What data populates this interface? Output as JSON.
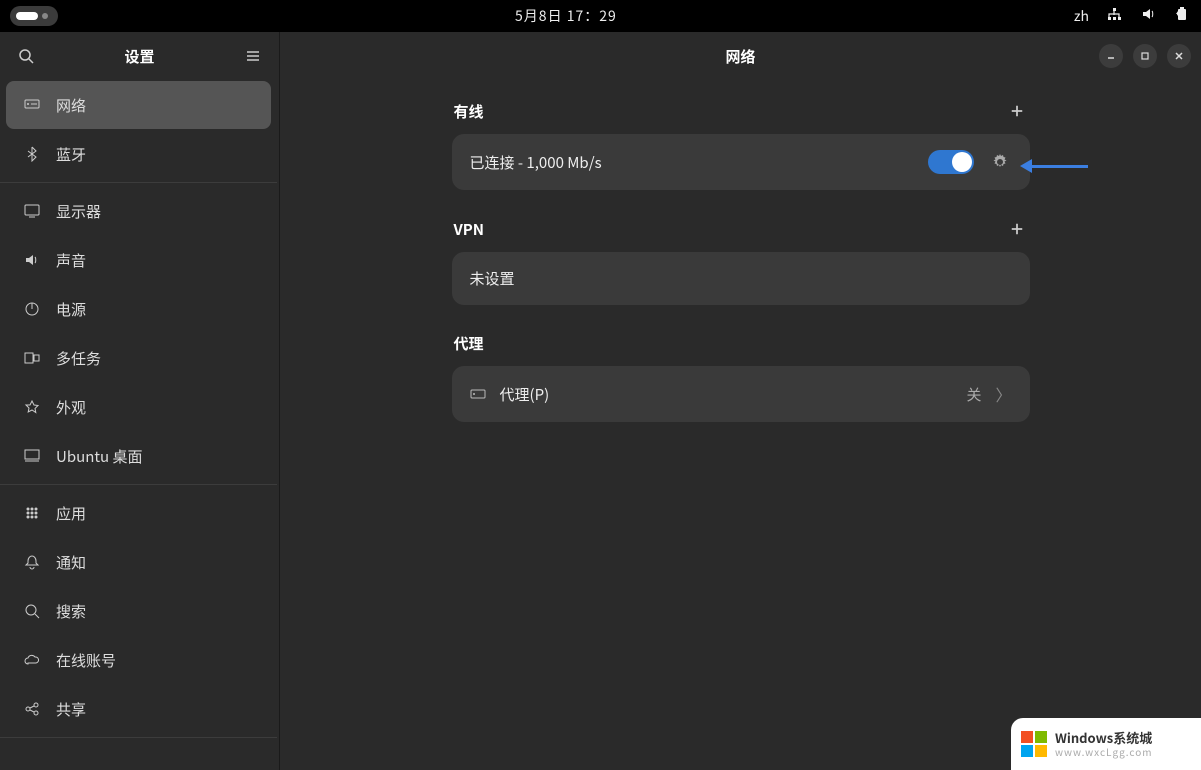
{
  "topbar": {
    "date_time": "5月8日  17：29",
    "input_method": "zh"
  },
  "sidebar": {
    "title": "设置",
    "items": [
      {
        "label": "网络"
      },
      {
        "label": "蓝牙"
      },
      {
        "label": "显示器"
      },
      {
        "label": "声音"
      },
      {
        "label": "电源"
      },
      {
        "label": "多任务"
      },
      {
        "label": "外观"
      },
      {
        "label": "Ubuntu 桌面"
      },
      {
        "label": "应用"
      },
      {
        "label": "通知"
      },
      {
        "label": "搜索"
      },
      {
        "label": "在线账号"
      },
      {
        "label": "共享"
      }
    ]
  },
  "content": {
    "title": "网络",
    "wired": {
      "heading": "有线",
      "status": "已连接 - 1,000 Mb/s",
      "enabled": true
    },
    "vpn": {
      "heading": "VPN",
      "status": "未设置"
    },
    "proxy": {
      "heading": "代理",
      "row_label": "代理(P)",
      "state": "关"
    }
  },
  "watermark": {
    "title": "Windows系统城",
    "url": "www.wxcLgg.com"
  }
}
